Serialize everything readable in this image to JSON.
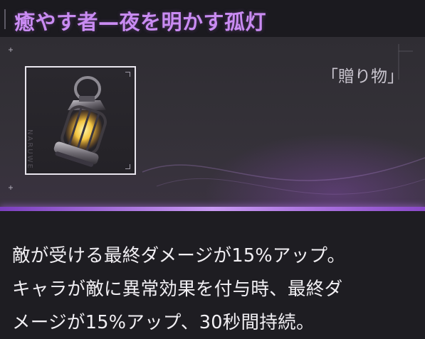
{
  "header": {
    "title": "癒やす者—夜を明かす孤灯"
  },
  "item": {
    "category": "「贈り物」",
    "icon": "lantern-icon",
    "side_text": "NARUWE"
  },
  "description": {
    "lines": [
      "敵が受ける最終ダメージが15%アップ。",
      "キャラが敵に異常効果を付与時、最終ダ",
      "メージが15%アップ、30秒間持続。"
    ]
  },
  "colors": {
    "title": "#c98bf2",
    "accent_line": "#c99af3",
    "text": "#f2f0f4"
  }
}
